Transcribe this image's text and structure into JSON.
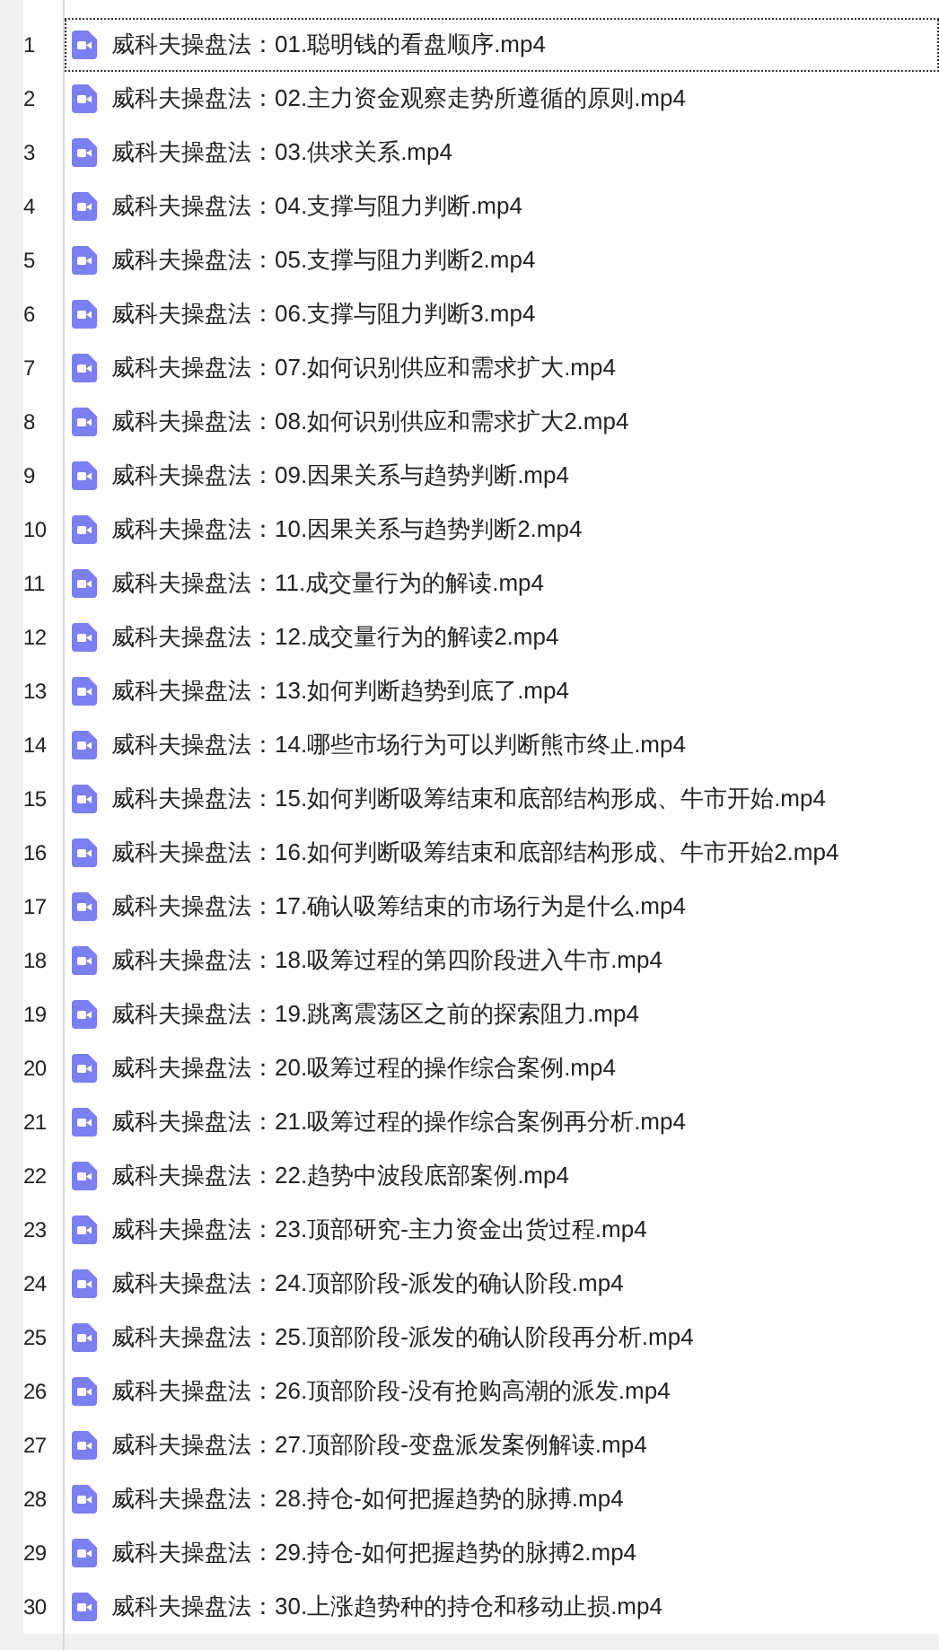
{
  "rows": [
    {
      "number": "1",
      "name": "威科夫操盘法：01.聪明钱的看盘顺序.mp4",
      "selected": true
    },
    {
      "number": "2",
      "name": "威科夫操盘法：02.主力资金观察走势所遵循的原则.mp4",
      "selected": false
    },
    {
      "number": "3",
      "name": "威科夫操盘法：03.供求关系.mp4",
      "selected": false
    },
    {
      "number": "4",
      "name": "威科夫操盘法：04.支撑与阻力判断.mp4",
      "selected": false
    },
    {
      "number": "5",
      "name": "威科夫操盘法：05.支撑与阻力判断2.mp4",
      "selected": false
    },
    {
      "number": "6",
      "name": "威科夫操盘法：06.支撑与阻力判断3.mp4",
      "selected": false
    },
    {
      "number": "7",
      "name": "威科夫操盘法：07.如何识别供应和需求扩大.mp4",
      "selected": false
    },
    {
      "number": "8",
      "name": "威科夫操盘法：08.如何识别供应和需求扩大2.mp4",
      "selected": false
    },
    {
      "number": "9",
      "name": "威科夫操盘法：09.因果关系与趋势判断.mp4",
      "selected": false
    },
    {
      "number": "10",
      "name": "威科夫操盘法：10.因果关系与趋势判断2.mp4",
      "selected": false
    },
    {
      "number": "11",
      "name": "威科夫操盘法：11.成交量行为的解读.mp4",
      "selected": false
    },
    {
      "number": "12",
      "name": "威科夫操盘法：12.成交量行为的解读2.mp4",
      "selected": false
    },
    {
      "number": "13",
      "name": "威科夫操盘法：13.如何判断趋势到底了.mp4",
      "selected": false
    },
    {
      "number": "14",
      "name": "威科夫操盘法：14.哪些市场行为可以判断熊市终止.mp4",
      "selected": false
    },
    {
      "number": "15",
      "name": "威科夫操盘法：15.如何判断吸筹结束和底部结构形成、牛市开始.mp4",
      "selected": false
    },
    {
      "number": "16",
      "name": "威科夫操盘法：16.如何判断吸筹结束和底部结构形成、牛市开始2.mp4",
      "selected": false
    },
    {
      "number": "17",
      "name": "威科夫操盘法：17.确认吸筹结束的市场行为是什么.mp4",
      "selected": false
    },
    {
      "number": "18",
      "name": "威科夫操盘法：18.吸筹过程的第四阶段进入牛市.mp4",
      "selected": false
    },
    {
      "number": "19",
      "name": "威科夫操盘法：19.跳离震荡区之前的探索阻力.mp4",
      "selected": false
    },
    {
      "number": "20",
      "name": "威科夫操盘法：20.吸筹过程的操作综合案例.mp4",
      "selected": false
    },
    {
      "number": "21",
      "name": "威科夫操盘法：21.吸筹过程的操作综合案例再分析.mp4",
      "selected": false
    },
    {
      "number": "22",
      "name": "威科夫操盘法：22.趋势中波段底部案例.mp4",
      "selected": false
    },
    {
      "number": "23",
      "name": "威科夫操盘法：23.顶部研究-主力资金出货过程.mp4",
      "selected": false
    },
    {
      "number": "24",
      "name": "威科夫操盘法：24.顶部阶段-派发的确认阶段.mp4",
      "selected": false
    },
    {
      "number": "25",
      "name": "威科夫操盘法：25.顶部阶段-派发的确认阶段再分析.mp4",
      "selected": false
    },
    {
      "number": "26",
      "name": "威科夫操盘法：26.顶部阶段-没有抢购高潮的派发.mp4",
      "selected": false
    },
    {
      "number": "27",
      "name": "威科夫操盘法：27.顶部阶段-变盘派发案例解读.mp4",
      "selected": false
    },
    {
      "number": "28",
      "name": "威科夫操盘法：28.持仓-如何把握趋势的脉搏.mp4",
      "selected": false
    },
    {
      "number": "29",
      "name": "威科夫操盘法：29.持仓-如何把握趋势的脉搏2.mp4",
      "selected": false
    },
    {
      "number": "30",
      "name": "威科夫操盘法：30.上涨趋势种的持仓和移动止损.mp4",
      "selected": false
    }
  ]
}
